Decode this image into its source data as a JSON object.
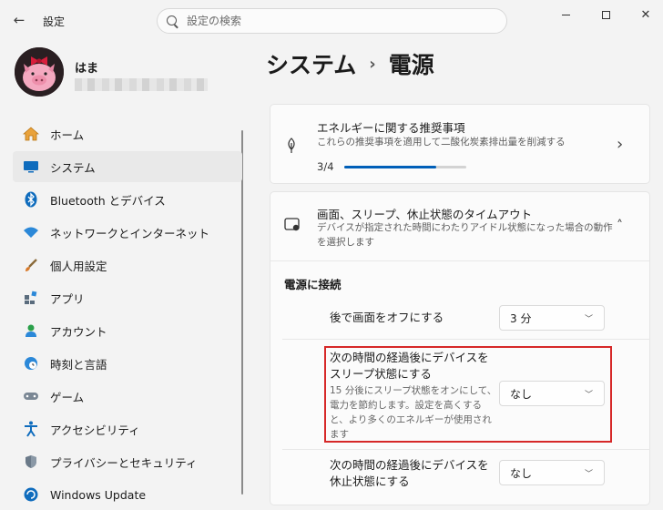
{
  "window": {
    "title": "設定",
    "back_glyph": "←",
    "minimize_label": "—",
    "close_glyph": "✕"
  },
  "search": {
    "placeholder": "設定の検索"
  },
  "profile": {
    "name": "はま"
  },
  "sidebar": {
    "items": [
      {
        "label": "ホーム",
        "icon": "home-icon"
      },
      {
        "label": "システム",
        "icon": "system-icon",
        "selected": true
      },
      {
        "label": "Bluetooth とデバイス",
        "icon": "bluetooth-icon"
      },
      {
        "label": "ネットワークとインターネット",
        "icon": "wifi-icon"
      },
      {
        "label": "個人用設定",
        "icon": "brush-icon"
      },
      {
        "label": "アプリ",
        "icon": "apps-icon"
      },
      {
        "label": "アカウント",
        "icon": "account-icon"
      },
      {
        "label": "時刻と言語",
        "icon": "globe-clock-icon"
      },
      {
        "label": "ゲーム",
        "icon": "gamepad-icon"
      },
      {
        "label": "アクセシビリティ",
        "icon": "accessibility-icon"
      },
      {
        "label": "プライバシーとセキュリティ",
        "icon": "shield-icon"
      },
      {
        "label": "Windows Update",
        "icon": "update-icon"
      }
    ]
  },
  "breadcrumb": {
    "parent": "システム",
    "separator": "›",
    "current": "電源"
  },
  "energy_card": {
    "title": "エネルギーに関する推奨事項",
    "subtitle": "これらの推奨事項を適用して二酸化炭素排出量を削減する",
    "progress_label": "3/4",
    "progress_fraction": 0.75,
    "chevron": "›"
  },
  "timeout_card": {
    "title": "画面、スリープ、休止状態のタイムアウト",
    "subtitle_line1": "デバイスが指定された時間にわたりアイドル状態になった場合の動作",
    "subtitle_line2": "を選択します",
    "chevron": "˄",
    "section_header": "電源に接続",
    "rows": [
      {
        "label_line1": "後で画面をオフにする",
        "value": "3 分"
      },
      {
        "label_line1": "次の時間の経過後にデバイスを",
        "label_line2": "スリープ状態にする",
        "desc_line1": "15 分後にスリープ状態をオンにして、",
        "desc_line2": "電力を節約します。設定を高くする",
        "desc_line3": "と、より多くのエネルギーが使用され",
        "desc_line4": "ます",
        "value": "なし"
      },
      {
        "label_line1": "次の時間の経過後にデバイスを",
        "label_line2": "休止状態にする",
        "value": "なし"
      }
    ]
  },
  "colors": {
    "accent": "#005fb8",
    "highlight_border": "#d62828"
  }
}
